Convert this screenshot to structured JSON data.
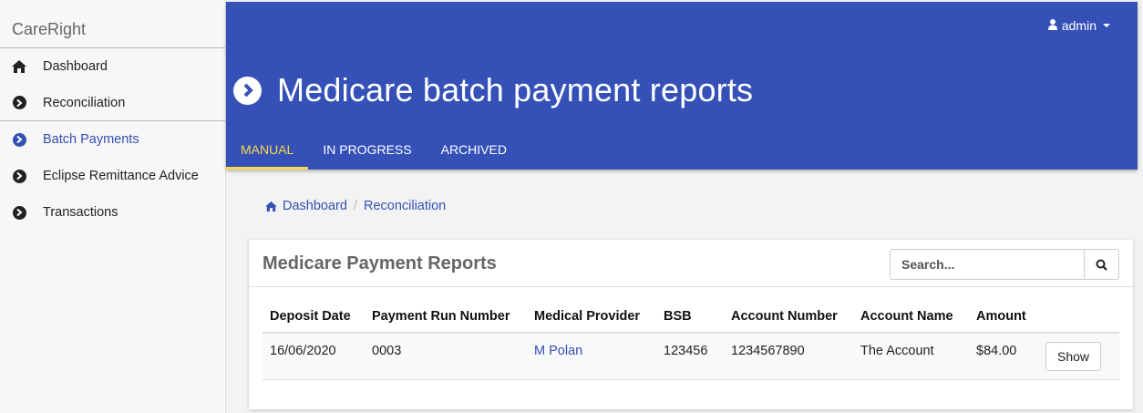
{
  "app": {
    "brand": "CareRight"
  },
  "sidebar": {
    "items": [
      {
        "label": "Dashboard",
        "icon": "home-icon"
      },
      {
        "label": "Reconciliation",
        "icon": "chevron-circle-right-icon"
      },
      {
        "label": "Batch Payments",
        "icon": "chevron-circle-right-icon",
        "active": true
      },
      {
        "label": "Eclipse Remittance Advice",
        "icon": "chevron-circle-right-icon"
      },
      {
        "label": "Transactions",
        "icon": "chevron-circle-right-icon"
      }
    ]
  },
  "header": {
    "user": "admin",
    "title": "Medicare batch payment reports",
    "tabs": [
      {
        "label": "MANUAL",
        "active": true
      },
      {
        "label": "IN PROGRESS"
      },
      {
        "label": "ARCHIVED"
      }
    ],
    "colors": {
      "background": "#3551b7",
      "active_tab": "#f5d94a"
    }
  },
  "breadcrumb": {
    "items": [
      {
        "label": "Dashboard",
        "icon": "home-icon"
      },
      {
        "label": "Reconciliation"
      }
    ]
  },
  "card": {
    "title": "Medicare Payment Reports",
    "search_placeholder": "Search...",
    "columns": [
      "Deposit Date",
      "Payment Run Number",
      "Medical Provider",
      "BSB",
      "Account Number",
      "Account Name",
      "Amount"
    ],
    "rows": [
      {
        "deposit_date": "16/06/2020",
        "payment_run_number": "0003",
        "medical_provider": "M Polan",
        "bsb": "123456",
        "account_number": "1234567890",
        "account_name": "The Account",
        "amount": "$84.00",
        "action": "Show"
      }
    ]
  }
}
